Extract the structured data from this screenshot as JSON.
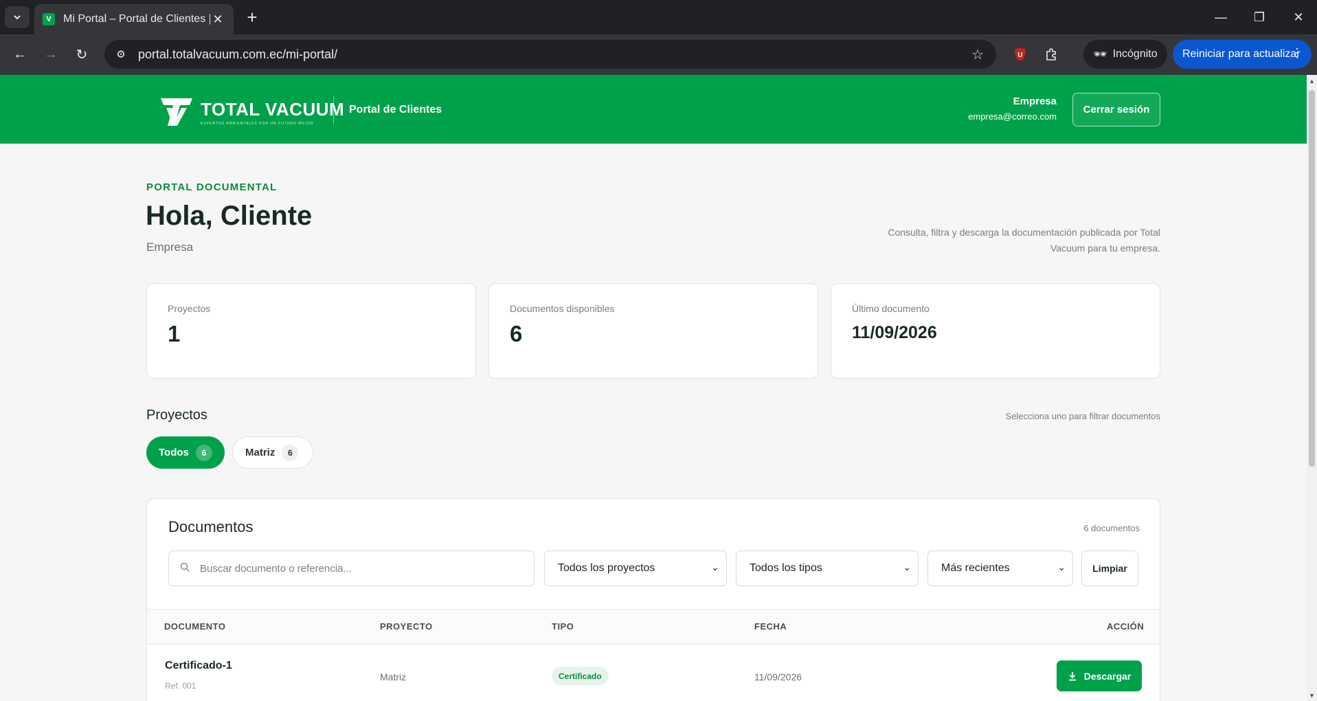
{
  "browser": {
    "tab_title": "Mi Portal – Portal de Clientes | T",
    "url": "portal.totalvacuum.com.ec/mi-portal/",
    "incognito_label": "Incógnito",
    "update_label": "Reiniciar para actualizar"
  },
  "header": {
    "logo_text": "TOTAL VACUUM",
    "logo_subtext": "EXPERTOS AMBIENTALES POR UN FUTURO MEJOR",
    "portal_title": "Portal de Clientes",
    "user_name": "Empresa",
    "user_email": "empresa@correo.com",
    "logout_label": "Cerrar sesión"
  },
  "hero": {
    "eyebrow": "PORTAL DOCUMENTAL",
    "greeting": "Hola, Cliente",
    "company": "Empresa",
    "intro": "Consulta, filtra y descarga la documentación publicada por Total Vacuum para tu empresa."
  },
  "stats": [
    {
      "label": "Proyectos",
      "value": "1"
    },
    {
      "label": "Documentos disponibles",
      "value": "6"
    },
    {
      "label": "Último documento",
      "value": "11/09/2026"
    }
  ],
  "projects": {
    "title": "Proyectos",
    "hint": "Selecciona uno para filtrar documentos",
    "chips": [
      {
        "label": "Todos",
        "count": "6"
      },
      {
        "label": "Matriz",
        "count": "6"
      }
    ]
  },
  "documents": {
    "title": "Documentos",
    "count_label": "6 documentos",
    "search_placeholder": "Buscar documento o referencia...",
    "filter_project": "Todos los proyectos",
    "filter_type": "Todos los tipos",
    "sort": "Más recientes",
    "clear_label": "Limpiar",
    "columns": [
      "DOCUMENTO",
      "PROYECTO",
      "TIPO",
      "FECHA",
      "ACCIÓN"
    ],
    "rows": [
      {
        "name": "Certificado-1",
        "ref": "Ref. 001",
        "project": "Matriz",
        "type": "Certificado",
        "date": "11/09/2026",
        "action": "Descargar"
      }
    ]
  },
  "colors": {
    "brand_green": "#00a14b",
    "browser_update_blue": "#0b57d0"
  }
}
